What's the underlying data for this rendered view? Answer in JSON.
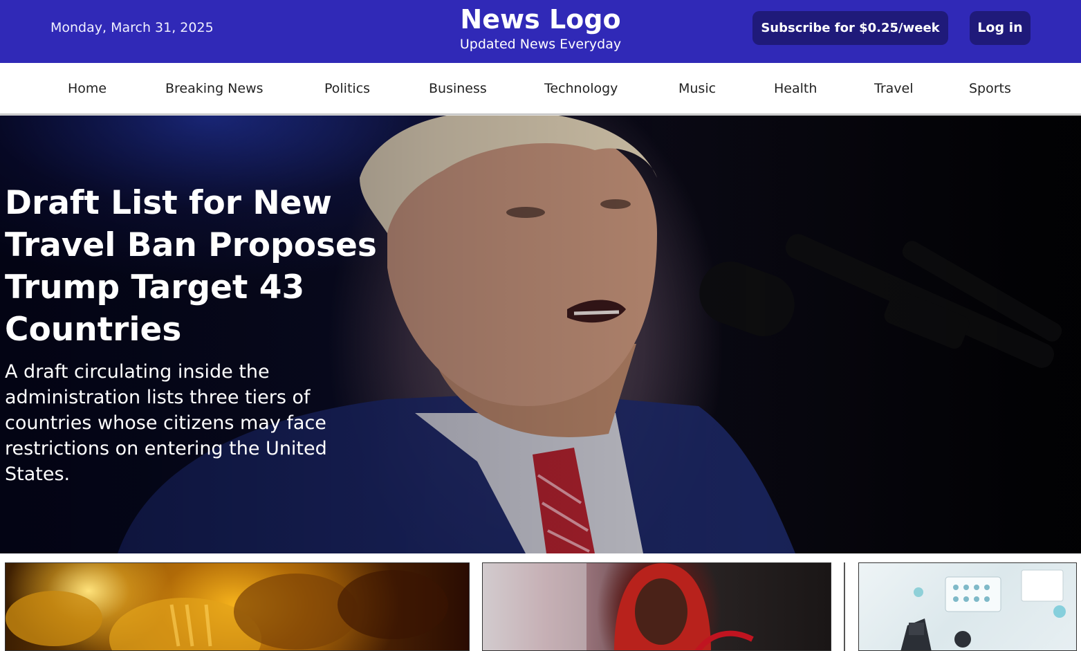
{
  "header": {
    "date": "Monday, March 31, 2025",
    "logo": "News Logo",
    "tagline": "Updated News Everyday",
    "subscribe_label": "Subscribe for $0.25/week",
    "login_label": "Log in"
  },
  "nav": {
    "items": [
      "Home",
      "Breaking News",
      "Politics",
      "Business",
      "Technology",
      "Music",
      "Health",
      "Travel",
      "Sports"
    ]
  },
  "hero": {
    "title": "Draft List for New Travel Ban Proposes Trump Target 43 Countries",
    "summary": "A draft circulating inside the administration lists three tiers of countries whose citizens may face restrictions on entering the United States."
  },
  "colors": {
    "header_bg": "#3029b7",
    "button_bg": "#1f1a7a",
    "text_on_dark": "#ffffff"
  }
}
